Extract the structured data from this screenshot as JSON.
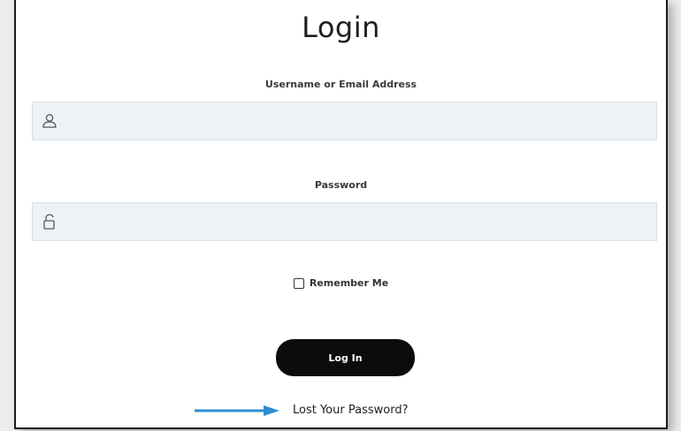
{
  "form": {
    "title": "Login",
    "username_label": "Username or Email Address",
    "username_value": "",
    "password_label": "Password",
    "password_value": "",
    "remember_label": "Remember Me",
    "remember_checked": false,
    "submit_label": "Log In",
    "lost_password_label": "Lost Your Password?"
  },
  "icons": {
    "username": "user-icon",
    "password": "unlock-icon",
    "annotation": "arrow-right-icon"
  },
  "colors": {
    "button_bg": "#0c0c0c",
    "field_bg": "#eef2f4",
    "arrow": "#2b8fd1"
  }
}
